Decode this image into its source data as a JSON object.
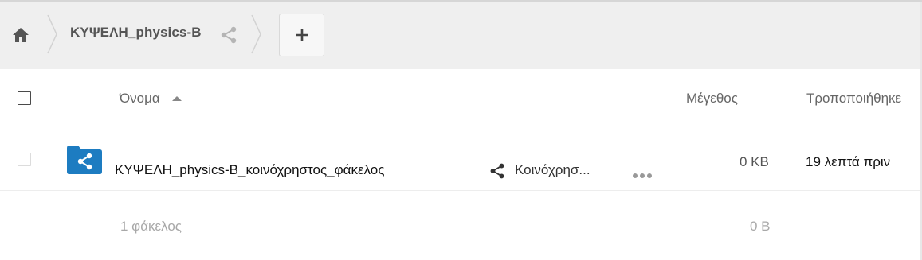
{
  "breadcrumb": {
    "home_icon": "home-icon",
    "folder_label": "ΚΥΨΕΛΗ_physics-B",
    "share_icon": "share-icon",
    "new_button_icon": "plus-icon"
  },
  "table": {
    "columns": {
      "name": "Όνομα",
      "size": "Μέγεθος",
      "modified": "Τροποποιήθηκε"
    },
    "sort": {
      "column": "name",
      "direction": "ascending"
    },
    "rows": [
      {
        "icon": "shared-folder-icon",
        "name": "ΚΥΨΕΛΗ_physics-B_κοινόχρηστος_φάκελος",
        "share_label": "Κοινόχρησ...",
        "more_icon": "more-dots-icon",
        "size": "0 KB",
        "modified": "19 λεπτά πριν"
      }
    ]
  },
  "summary": {
    "count": "1 φάκελος",
    "size": "0 B"
  },
  "colors": {
    "folder": "#1d7cc1",
    "toolbar_bg": "#efefef"
  }
}
